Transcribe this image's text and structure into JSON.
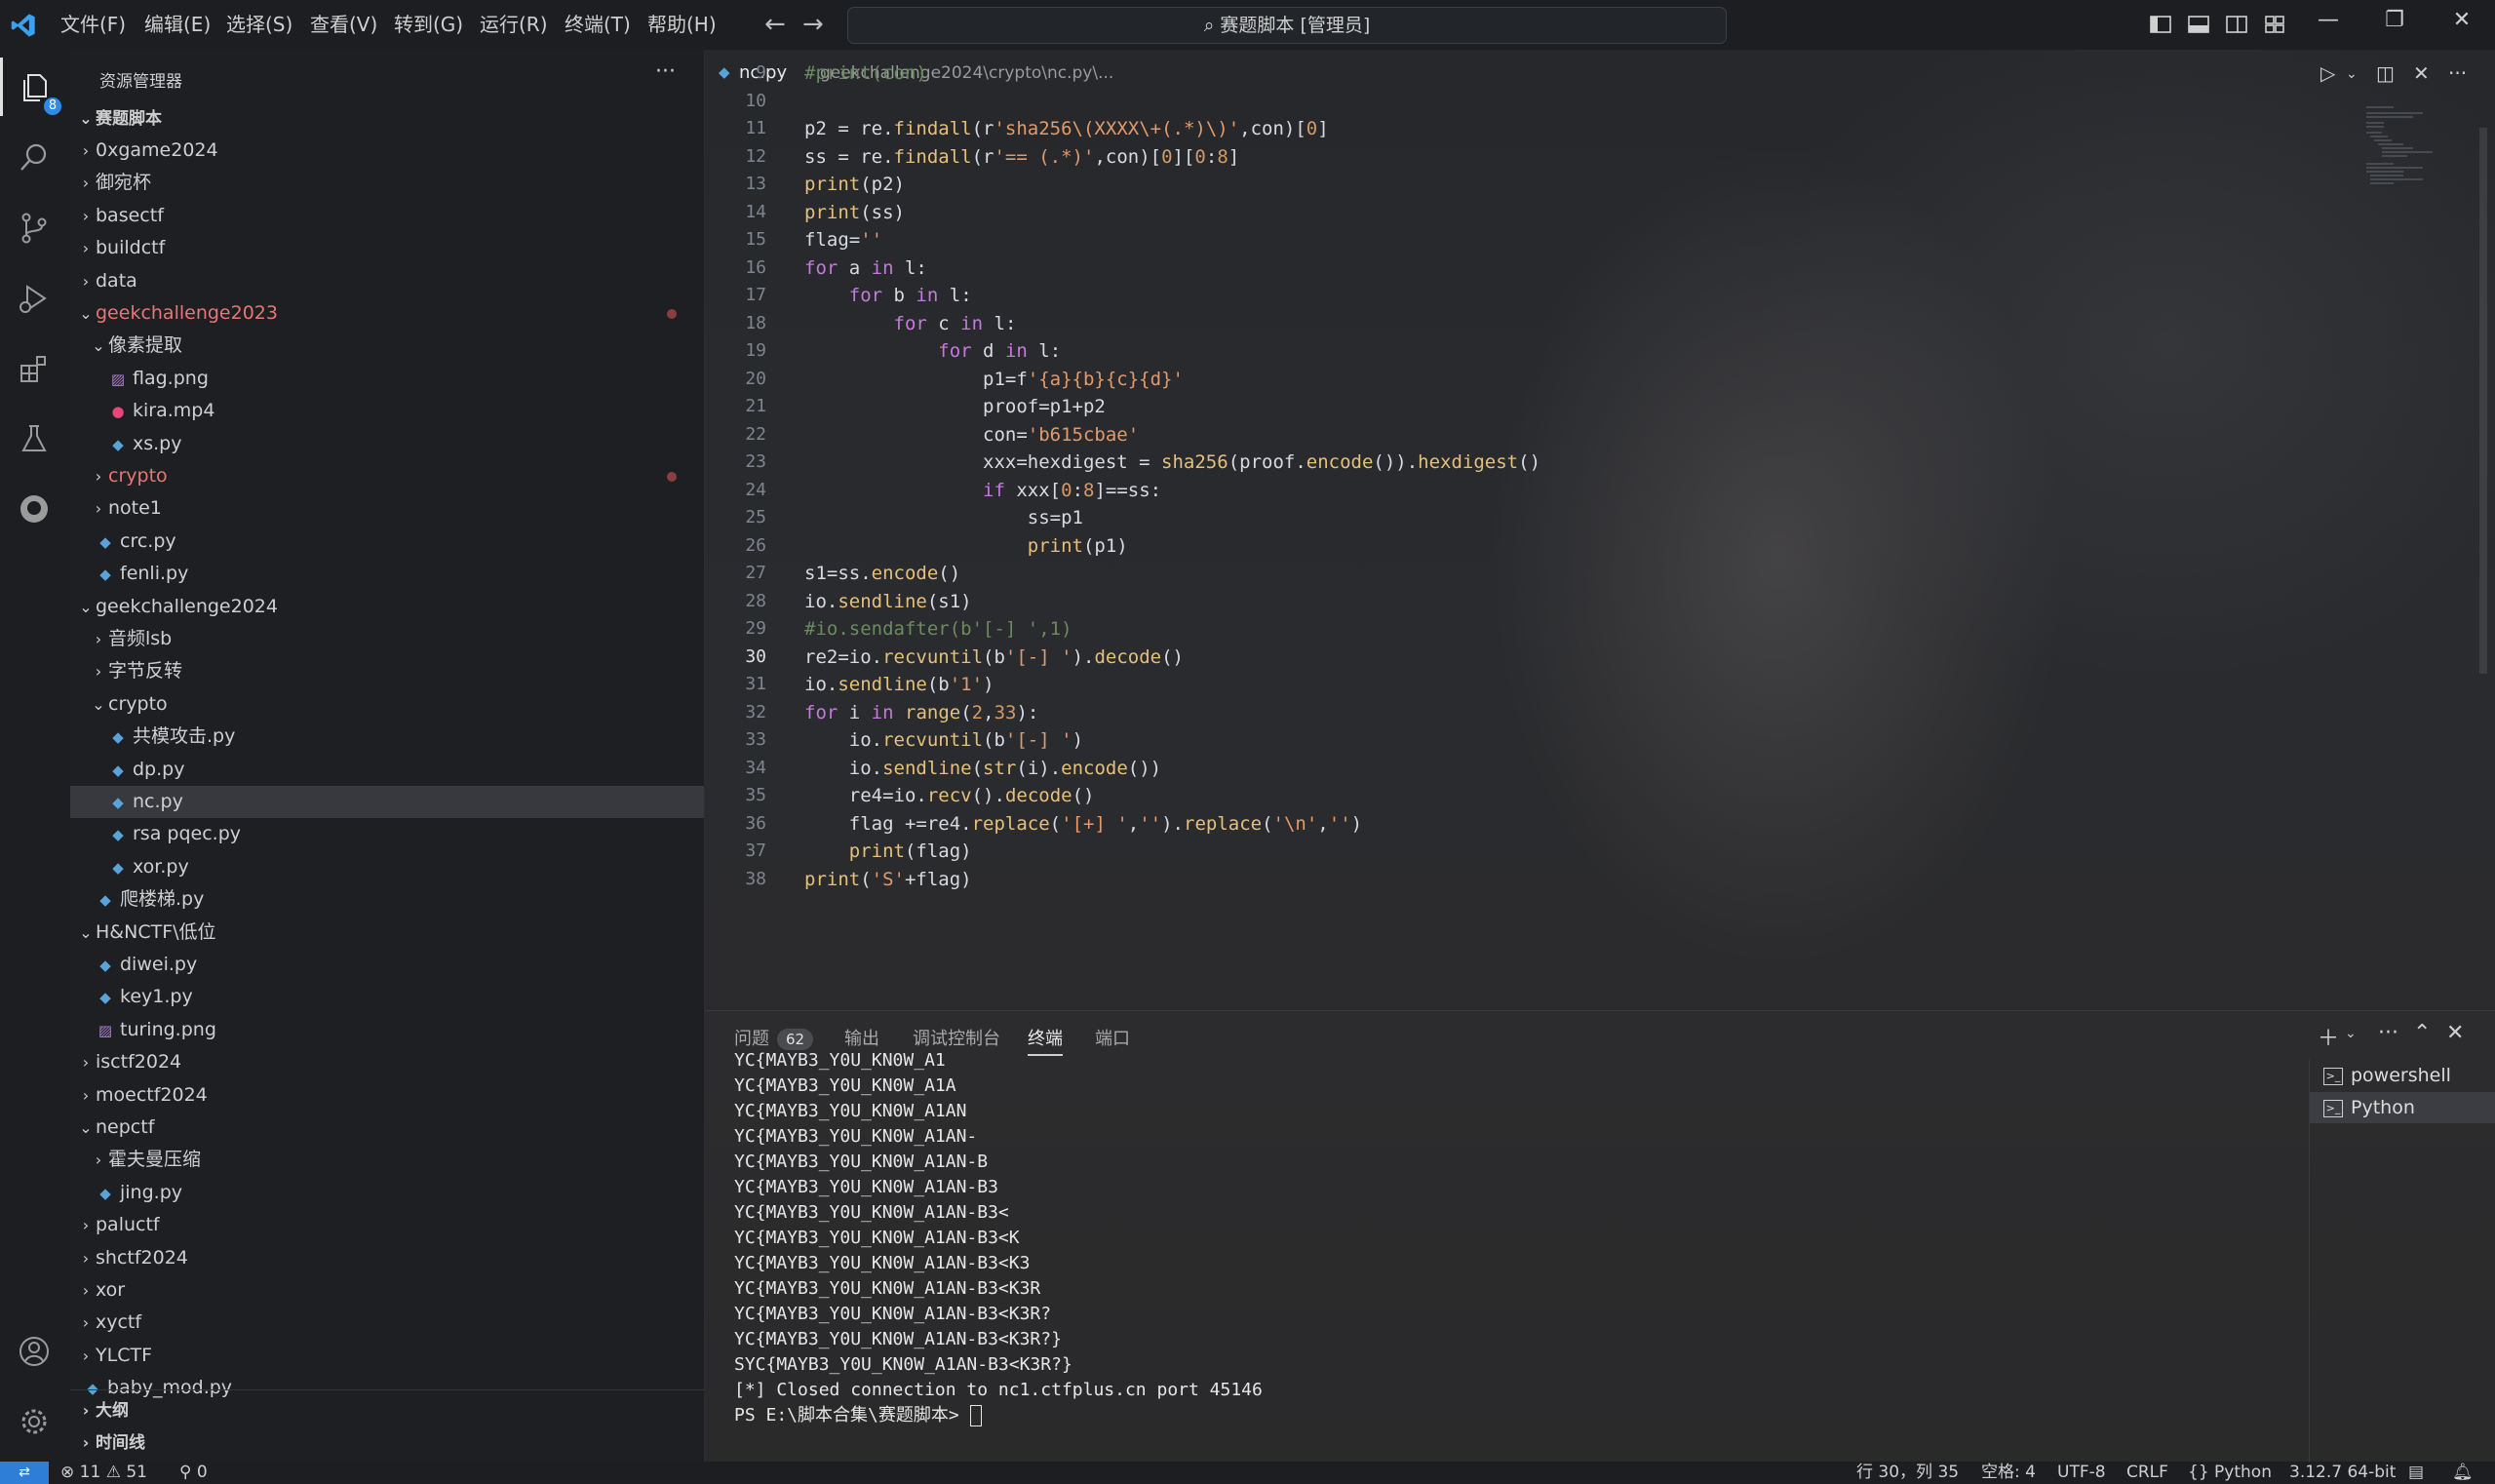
{
  "titlebar": {
    "menus": [
      "文件(F)",
      "编辑(E)",
      "选择(S)",
      "查看(V)",
      "转到(G)",
      "运行(R)",
      "终端(T)",
      "帮助(H)"
    ],
    "search_text": "赛题脚本 [管理员]"
  },
  "activity": {
    "explorer_badge": "8"
  },
  "sidebar": {
    "title": "资源管理器",
    "more": "···",
    "root": "赛题脚本",
    "tree": [
      {
        "label": "0xgame2024",
        "kind": "folder",
        "open": false,
        "level": 1
      },
      {
        "label": "御宛杯",
        "kind": "folder",
        "open": false,
        "level": 1
      },
      {
        "label": "basectf",
        "kind": "folder",
        "open": false,
        "level": 1
      },
      {
        "label": "buildctf",
        "kind": "folder",
        "open": false,
        "level": 1
      },
      {
        "label": "data",
        "kind": "folder",
        "open": false,
        "level": 1
      },
      {
        "label": "geekchallenge2023",
        "kind": "folder",
        "open": true,
        "level": 1,
        "modified": true
      },
      {
        "label": "像素提取",
        "kind": "folder",
        "open": true,
        "level": 2
      },
      {
        "label": "flag.png",
        "kind": "png",
        "level": 3
      },
      {
        "label": "kira.mp4",
        "kind": "mp4",
        "level": 3
      },
      {
        "label": "xs.py",
        "kind": "py",
        "level": 3
      },
      {
        "label": "crypto",
        "kind": "folder",
        "open": false,
        "level": 2,
        "modified": true
      },
      {
        "label": "note1",
        "kind": "folder",
        "open": false,
        "level": 2
      },
      {
        "label": "crc.py",
        "kind": "py",
        "level": 2
      },
      {
        "label": "fenli.py",
        "kind": "py",
        "level": 2
      },
      {
        "label": "geekchallenge2024",
        "kind": "folder",
        "open": true,
        "level": 1
      },
      {
        "label": "音频lsb",
        "kind": "folder",
        "open": false,
        "level": 2
      },
      {
        "label": "字节反转",
        "kind": "folder",
        "open": false,
        "level": 2
      },
      {
        "label": "crypto",
        "kind": "folder",
        "open": true,
        "level": 2
      },
      {
        "label": "共模攻击.py",
        "kind": "py",
        "level": 3
      },
      {
        "label": "dp.py",
        "kind": "py",
        "level": 3
      },
      {
        "label": "nc.py",
        "kind": "py",
        "level": 3,
        "selected": true
      },
      {
        "label": "rsa pqec.py",
        "kind": "py",
        "level": 3
      },
      {
        "label": "xor.py",
        "kind": "py",
        "level": 3
      },
      {
        "label": "爬楼梯.py",
        "kind": "py",
        "level": 2
      },
      {
        "label": "H&NCTF\\低位",
        "kind": "folder",
        "open": true,
        "level": 1
      },
      {
        "label": "diwei.py",
        "kind": "py",
        "level": 2
      },
      {
        "label": "key1.py",
        "kind": "py",
        "level": 2
      },
      {
        "label": "turing.png",
        "kind": "png",
        "level": 2
      },
      {
        "label": "isctf2024",
        "kind": "folder",
        "open": false,
        "level": 1
      },
      {
        "label": "moectf2024",
        "kind": "folder",
        "open": false,
        "level": 1
      },
      {
        "label": "nepctf",
        "kind": "folder",
        "open": true,
        "level": 1
      },
      {
        "label": "霍夫曼压缩",
        "kind": "folder",
        "open": false,
        "level": 2
      },
      {
        "label": "jing.py",
        "kind": "py",
        "level": 2
      },
      {
        "label": "paluctf",
        "kind": "folder",
        "open": false,
        "level": 1
      },
      {
        "label": "shctf2024",
        "kind": "folder",
        "open": false,
        "level": 1
      },
      {
        "label": "xor",
        "kind": "folder",
        "open": false,
        "level": 1
      },
      {
        "label": "xyctf",
        "kind": "folder",
        "open": false,
        "level": 1
      },
      {
        "label": "YLCTF",
        "kind": "folder",
        "open": false,
        "level": 1
      },
      {
        "label": "baby_mod.py",
        "kind": "py",
        "level": 1
      }
    ],
    "outline": "大纲",
    "timeline": "时间线"
  },
  "editor": {
    "tab_file": "nc.py",
    "tab_path": "geekchallenge2024\\crypto\\nc.py\\...",
    "current_line": 30,
    "lines": [
      {
        "n": 9,
        "html": "<span class='c'>#print(con)</span>"
      },
      {
        "n": 10,
        "html": ""
      },
      {
        "n": 11,
        "html": "p2 = re.<span class='f'>findall</span>(r<span class='s'>'sha256\\(XXXX\\+(.*)\\)'</span>,con)[<span class='n'>0</span>]"
      },
      {
        "n": 12,
        "html": "ss = re.<span class='f'>findall</span>(r<span class='s'>'== (.*)'</span>,con)[<span class='n'>0</span>][<span class='n'>0</span>:<span class='n'>8</span>]"
      },
      {
        "n": 13,
        "html": "<span class='f'>print</span>(p2)"
      },
      {
        "n": 14,
        "html": "<span class='f'>print</span>(ss)"
      },
      {
        "n": 15,
        "html": "flag=<span class='s'>''</span>"
      },
      {
        "n": 16,
        "html": "<span class='k'>for</span> a <span class='k'>in</span> l:"
      },
      {
        "n": 17,
        "html": "    <span class='k'>for</span> b <span class='k'>in</span> l:"
      },
      {
        "n": 18,
        "html": "        <span class='k'>for</span> c <span class='k'>in</span> l:"
      },
      {
        "n": 19,
        "html": "            <span class='k'>for</span> d <span class='k'>in</span> l:"
      },
      {
        "n": 20,
        "html": "                p1=f<span class='s'>'{a}{b}{c}{d}'</span>"
      },
      {
        "n": 21,
        "html": "                proof=p1+p2"
      },
      {
        "n": 22,
        "html": "                con=<span class='s'>'b615cbae'</span>"
      },
      {
        "n": 23,
        "html": "                xxx=hexdigest = <span class='f'>sha256</span>(proof.<span class='f'>encode</span>()).<span class='f'>hexdigest</span>()"
      },
      {
        "n": 24,
        "html": "                <span class='k'>if</span> xxx[<span class='n'>0</span>:<span class='n'>8</span>]==ss:"
      },
      {
        "n": 25,
        "html": "                    ss=p1"
      },
      {
        "n": 26,
        "html": "                    <span class='f'>print</span>(p1)"
      },
      {
        "n": 27,
        "html": "s1=ss.<span class='f'>encode</span>()"
      },
      {
        "n": 28,
        "html": "io.<span class='f'>sendline</span>(s1)"
      },
      {
        "n": 29,
        "html": "<span class='c'>#io.sendafter(b'[-] ',1)</span>"
      },
      {
        "n": 30,
        "html": "re2=io.<span class='f'>recvuntil</span>(b<span class='s'>'[-] '</span>).<span class='f'>decode</span>()"
      },
      {
        "n": 31,
        "html": "io.<span class='f'>sendline</span>(b<span class='s'>'1'</span>)"
      },
      {
        "n": 32,
        "html": "<span class='k'>for</span> i <span class='k'>in</span> <span class='f'>range</span>(<span class='n'>2</span>,<span class='n'>33</span>):"
      },
      {
        "n": 33,
        "html": "    io.<span class='f'>recvuntil</span>(b<span class='s'>'[-] '</span>)"
      },
      {
        "n": 34,
        "html": "    io.<span class='f'>sendline</span>(<span class='f'>str</span>(i).<span class='f'>encode</span>())"
      },
      {
        "n": 35,
        "html": "    re4=io.<span class='f'>recv</span>().<span class='f'>decode</span>()"
      },
      {
        "n": 36,
        "html": "    flag +=re4.<span class='f'>replace</span>(<span class='s'>'[+] '</span>,<span class='s'>''</span>).<span class='f'>replace</span>(<span class='s'>'\\n'</span>,<span class='s'>''</span>)"
      },
      {
        "n": 37,
        "html": "    <span class='f'>print</span>(flag)"
      },
      {
        "n": 38,
        "html": "<span class='f'>print</span>(<span class='s'>'S'</span>+flag)"
      }
    ]
  },
  "panel": {
    "tabs": [
      {
        "label": "问题",
        "badge": "62"
      },
      {
        "label": "输出"
      },
      {
        "label": "调试控制台"
      },
      {
        "label": "终端",
        "active": true
      },
      {
        "label": "端口"
      }
    ],
    "terminal_lines": [
      "YC{MAYB3_Y0U_KN0W_A1",
      "YC{MAYB3_Y0U_KN0W_A1A",
      "YC{MAYB3_Y0U_KN0W_A1AN",
      "YC{MAYB3_Y0U_KN0W_A1AN-",
      "YC{MAYB3_Y0U_KN0W_A1AN-B",
      "YC{MAYB3_Y0U_KN0W_A1AN-B3",
      "YC{MAYB3_Y0U_KN0W_A1AN-B3<",
      "YC{MAYB3_Y0U_KN0W_A1AN-B3<K",
      "YC{MAYB3_Y0U_KN0W_A1AN-B3<K3",
      "YC{MAYB3_Y0U_KN0W_A1AN-B3<K3R",
      "YC{MAYB3_Y0U_KN0W_A1AN-B3<K3R?",
      "YC{MAYB3_Y0U_KN0W_A1AN-B3<K3R?}",
      "SYC{MAYB3_Y0U_KN0W_A1AN-B3<K3R?}",
      "[*] Closed connection to nc1.ctfplus.cn port 45146",
      "PS E:\\脚本合集\\赛题脚本> "
    ],
    "terminals": [
      {
        "label": "powershell"
      },
      {
        "label": "Python",
        "selected": true
      }
    ]
  },
  "statusbar": {
    "errors": "11",
    "warnings": "51",
    "ports": "0",
    "position": "行 30，列 35",
    "spaces": "空格: 4",
    "encoding": "UTF-8",
    "eol": "CRLF",
    "language": "Python",
    "interpreter": "3.12.7 64-bit"
  }
}
